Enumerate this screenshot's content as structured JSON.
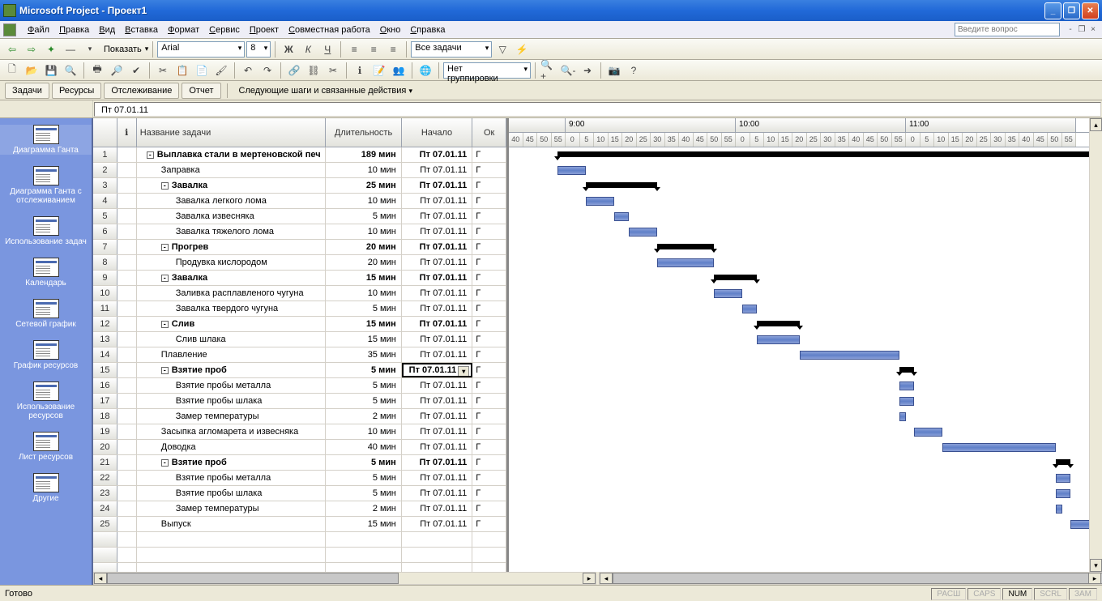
{
  "title": "Microsoft Project - Проект1",
  "question_placeholder": "Введите вопрос",
  "menu": [
    "Файл",
    "Правка",
    "Вид",
    "Вставка",
    "Формат",
    "Сервис",
    "Проект",
    "Совместная работа",
    "Окно",
    "Справка"
  ],
  "toolbar2": {
    "show": "Показать",
    "font": "Arial",
    "size": "8",
    "filter": "Все задачи",
    "group": "Нет группировки"
  },
  "guide": {
    "tabs": [
      "Задачи",
      "Ресурсы",
      "Отслеживание",
      "Отчет"
    ],
    "steps": "Следующие шаги и связанные действия"
  },
  "formula": "Пт 07.01.11",
  "viewbar": [
    {
      "label": "Диаграмма Ганта"
    },
    {
      "label": "Диаграмма Ганта с отслеживанием"
    },
    {
      "label": "Использование задач"
    },
    {
      "label": "Календарь"
    },
    {
      "label": "Сетевой график"
    },
    {
      "label": "График ресурсов"
    },
    {
      "label": "Использование ресурсов"
    },
    {
      "label": "Лист ресурсов"
    },
    {
      "label": "Другие"
    }
  ],
  "columns": {
    "info": "",
    "name": "Название задачи",
    "dur": "Длительность",
    "start": "Начало",
    "end": "Ок"
  },
  "tasks": [
    {
      "id": 1,
      "level": 0,
      "summary": true,
      "name": "Выплавка стали в мертеновской печ",
      "dur": "189 мин",
      "start": "Пт 07.01.11",
      "barStart": 60,
      "barLen": 700
    },
    {
      "id": 2,
      "level": 1,
      "name": "Заправка",
      "dur": "10 мин",
      "start": "Пт 07.01.11",
      "barStart": 60,
      "barLen": 35
    },
    {
      "id": 3,
      "level": 1,
      "summary": true,
      "name": "Завалка",
      "dur": "25 мин",
      "start": "Пт 07.01.11",
      "barStart": 95,
      "barLen": 88
    },
    {
      "id": 4,
      "level": 2,
      "name": "Завалка легкого лома",
      "dur": "10 мин",
      "start": "Пт 07.01.11",
      "barStart": 95,
      "barLen": 35
    },
    {
      "id": 5,
      "level": 2,
      "name": "Завалка извесняка",
      "dur": "5 мин",
      "start": "Пт 07.01.11",
      "barStart": 130,
      "barLen": 18
    },
    {
      "id": 6,
      "level": 2,
      "name": "Завалка тяжелого лома",
      "dur": "10 мин",
      "start": "Пт 07.01.11",
      "barStart": 148,
      "barLen": 35
    },
    {
      "id": 7,
      "level": 1,
      "summary": true,
      "name": "Прогрев",
      "dur": "20 мин",
      "start": "Пт 07.01.11",
      "barStart": 183,
      "barLen": 70
    },
    {
      "id": 8,
      "level": 2,
      "name": "Продувка кислородом",
      "dur": "20 мин",
      "start": "Пт 07.01.11",
      "barStart": 183,
      "barLen": 70
    },
    {
      "id": 9,
      "level": 1,
      "summary": true,
      "name": "Завалка",
      "dur": "15 мин",
      "start": "Пт 07.01.11",
      "barStart": 253,
      "barLen": 53
    },
    {
      "id": 10,
      "level": 2,
      "name": "Заливка расплавленого чугуна",
      "dur": "10 мин",
      "start": "Пт 07.01.11",
      "barStart": 253,
      "barLen": 35
    },
    {
      "id": 11,
      "level": 2,
      "name": "Завалка твердого чугуна",
      "dur": "5 мин",
      "start": "Пт 07.01.11",
      "barStart": 288,
      "barLen": 18
    },
    {
      "id": 12,
      "level": 1,
      "summary": true,
      "name": "Слив",
      "dur": "15 мин",
      "start": "Пт 07.01.11",
      "barStart": 306,
      "barLen": 53
    },
    {
      "id": 13,
      "level": 2,
      "name": "Слив шлака",
      "dur": "15 мин",
      "start": "Пт 07.01.11",
      "barStart": 306,
      "barLen": 53
    },
    {
      "id": 14,
      "level": 1,
      "name": "Плавление",
      "dur": "35 мин",
      "start": "Пт 07.01.11",
      "barStart": 359,
      "barLen": 123
    },
    {
      "id": 15,
      "level": 1,
      "summary": true,
      "name": "Взятие проб",
      "dur": "5 мин",
      "start": "Пт 07.01.11",
      "selected": true,
      "barStart": 482,
      "barLen": 18
    },
    {
      "id": 16,
      "level": 2,
      "name": "Взятие пробы металла",
      "dur": "5 мин",
      "start": "Пт 07.01.11",
      "barStart": 482,
      "barLen": 18
    },
    {
      "id": 17,
      "level": 2,
      "name": "Взятие пробы шлака",
      "dur": "5 мин",
      "start": "Пт 07.01.11",
      "barStart": 482,
      "barLen": 18
    },
    {
      "id": 18,
      "level": 2,
      "name": "Замер температуры",
      "dur": "2 мин",
      "start": "Пт 07.01.11",
      "barStart": 482,
      "barLen": 8
    },
    {
      "id": 19,
      "level": 1,
      "name": "Засыпка агломарета и извесняка",
      "dur": "10 мин",
      "start": "Пт 07.01.11",
      "barStart": 500,
      "barLen": 35
    },
    {
      "id": 20,
      "level": 1,
      "name": "Доводка",
      "dur": "40 мин",
      "start": "Пт 07.01.11",
      "barStart": 535,
      "barLen": 140
    },
    {
      "id": 21,
      "level": 1,
      "summary": true,
      "name": "Взятие проб",
      "dur": "5 мин",
      "start": "Пт 07.01.11",
      "barStart": 675,
      "barLen": 18
    },
    {
      "id": 22,
      "level": 2,
      "name": "Взятие пробы металла",
      "dur": "5 мин",
      "start": "Пт 07.01.11",
      "barStart": 675,
      "barLen": 18
    },
    {
      "id": 23,
      "level": 2,
      "name": "Взятие пробы шлака",
      "dur": "5 мин",
      "start": "Пт 07.01.11",
      "barStart": 675,
      "barLen": 18
    },
    {
      "id": 24,
      "level": 2,
      "name": "Замер температуры",
      "dur": "2 мин",
      "start": "Пт 07.01.11",
      "barStart": 675,
      "barLen": 8
    },
    {
      "id": 25,
      "level": 1,
      "name": "Выпуск",
      "dur": "15 мин",
      "start": "Пт 07.01.11",
      "barStart": 693,
      "barLen": 53
    }
  ],
  "timeline": {
    "hours": [
      "9:00",
      "10:00",
      "11:00"
    ],
    "ticks": [
      "40",
      "45",
      "50",
      "55",
      "0",
      "5",
      "10",
      "15",
      "20",
      "25",
      "30",
      "35",
      "40",
      "45",
      "50",
      "55",
      "0",
      "5",
      "10",
      "15",
      "20",
      "25",
      "30",
      "35",
      "40",
      "45",
      "50",
      "55",
      "0",
      "5",
      "10",
      "15",
      "20",
      "25",
      "30",
      "35",
      "40",
      "45",
      "50",
      "55"
    ]
  },
  "status": {
    "ready": "Готово",
    "indicators": [
      "РАСШ",
      "CAPS",
      "NUM",
      "SCRL",
      "ЗАМ"
    ]
  },
  "end_marker": "Г"
}
